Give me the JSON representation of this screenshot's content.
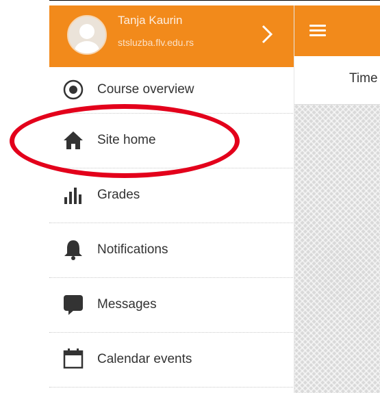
{
  "user": {
    "name": "Tanja Kaurin",
    "subtitle": "stsluzba.flv.edu.rs"
  },
  "menu": {
    "items": [
      {
        "label": "Course overview",
        "icon": "course-overview-icon"
      },
      {
        "label": "Site home",
        "icon": "home-icon"
      },
      {
        "label": "Grades",
        "icon": "grades-icon"
      },
      {
        "label": "Notifications",
        "icon": "bell-icon"
      },
      {
        "label": "Messages",
        "icon": "chat-icon"
      },
      {
        "label": "Calendar events",
        "icon": "calendar-icon"
      }
    ]
  },
  "header": {
    "tab_label": "Time"
  },
  "colors": {
    "accent": "#f28a1b",
    "highlight": "#e3001b"
  },
  "annotation": {
    "highlighted_item": "Site home"
  }
}
